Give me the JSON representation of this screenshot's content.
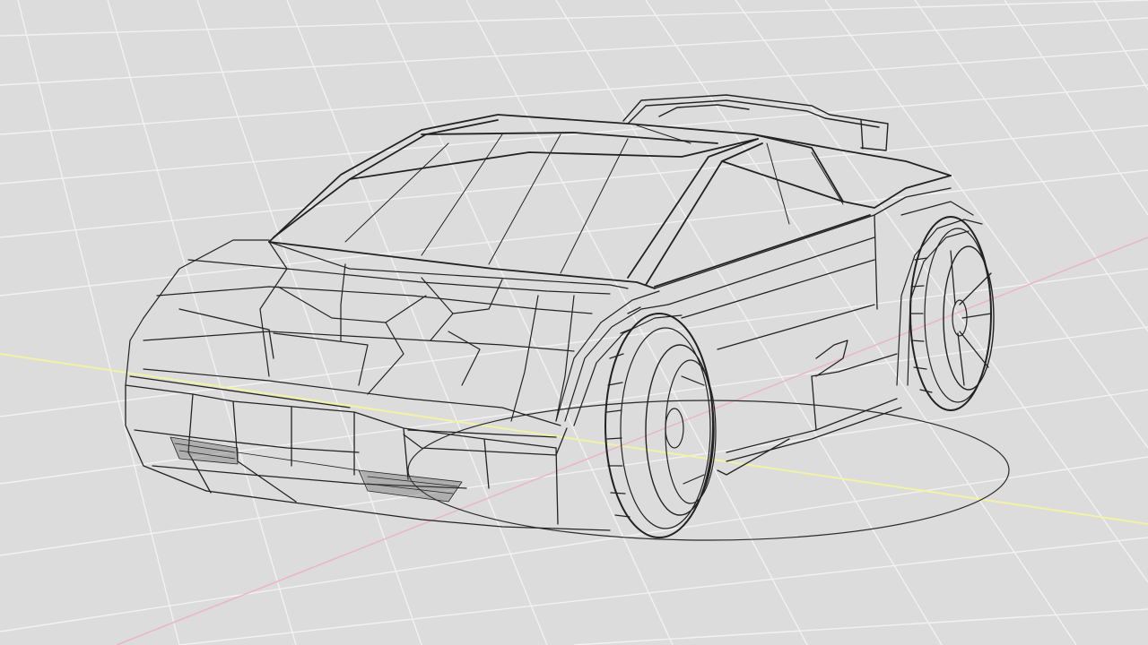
{
  "viewport": {
    "background_color": "#dcdcdc",
    "grid_color": "#f2f2f2",
    "x_axis_color": "#e9b7c8",
    "y_axis_color": "#f1f2a6",
    "wire_color": "#222222",
    "ground_shadow_color": "#2a2a2a",
    "model": "car-wireframe"
  }
}
